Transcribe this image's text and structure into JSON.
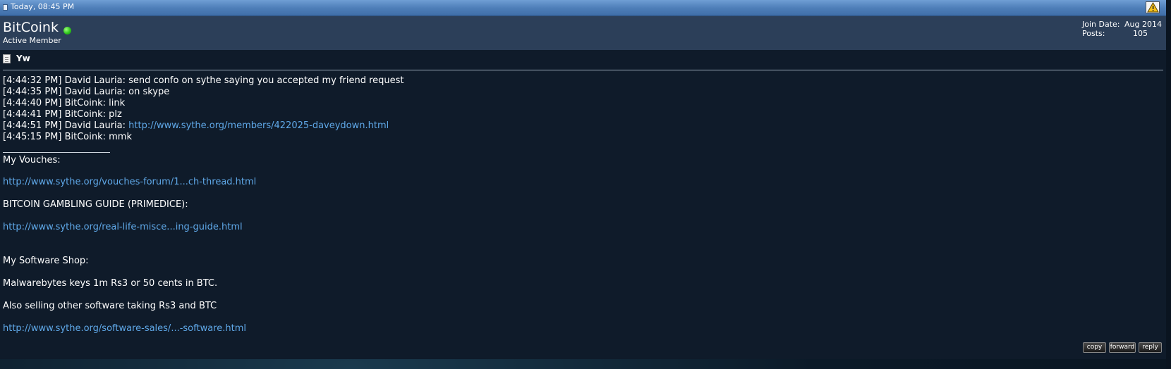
{
  "header": {
    "date": "Today, 08:45 PM",
    "report_icon": "warning-triangle-icon"
  },
  "user": {
    "name": "BitCoink",
    "title": "Active Member",
    "status_color": "#2fc61c",
    "join_label": "Join Date:",
    "join_value": "Aug 2014",
    "posts_label": "Posts:",
    "posts_value": "105"
  },
  "post": {
    "title": "Yw",
    "chat": [
      {
        "prefix": "[4:44:32 PM] David Lauria: send confo on sythe saying you accepted my friend request",
        "link": ""
      },
      {
        "prefix": "[4:44:35 PM] David Lauria: on skype",
        "link": ""
      },
      {
        "prefix": "[4:44:40 PM] BitCoink: link",
        "link": ""
      },
      {
        "prefix": "[4:44:41 PM] BitCoink: plz",
        "link": ""
      },
      {
        "prefix": "[4:44:51 PM] David Lauria: ",
        "link": "http://www.sythe.org/members/422025-daveydown.html"
      },
      {
        "prefix": "[4:45:15 PM] BitCoink: mmk",
        "link": ""
      }
    ]
  },
  "signature": {
    "vouches_label": "My Vouches:",
    "vouches_link": "http://www.sythe.org/vouches-forum/1...ch-thread.html",
    "guide_label": "BITCOIN GAMBLING GUIDE (PRIMEDICE):",
    "guide_link": "http://www.sythe.org/real-life-misce...ing-guide.html",
    "shop_label": "My Software Shop:",
    "shop_line1": "Malwarebytes keys 1m Rs3 or 50 cents in BTC.",
    "shop_line2": "Also selling other software taking Rs3 and BTC",
    "shop_link": "http://www.sythe.org/software-sales/...-software.html"
  },
  "buttons": {
    "copy": "copy",
    "forward": "forward",
    "reply": "reply"
  },
  "colors": {
    "link": "#5fa8e8",
    "header_bar": "#4f7fb9",
    "user_row": "#2c3f59",
    "post_bg": "#0f1b2a"
  }
}
